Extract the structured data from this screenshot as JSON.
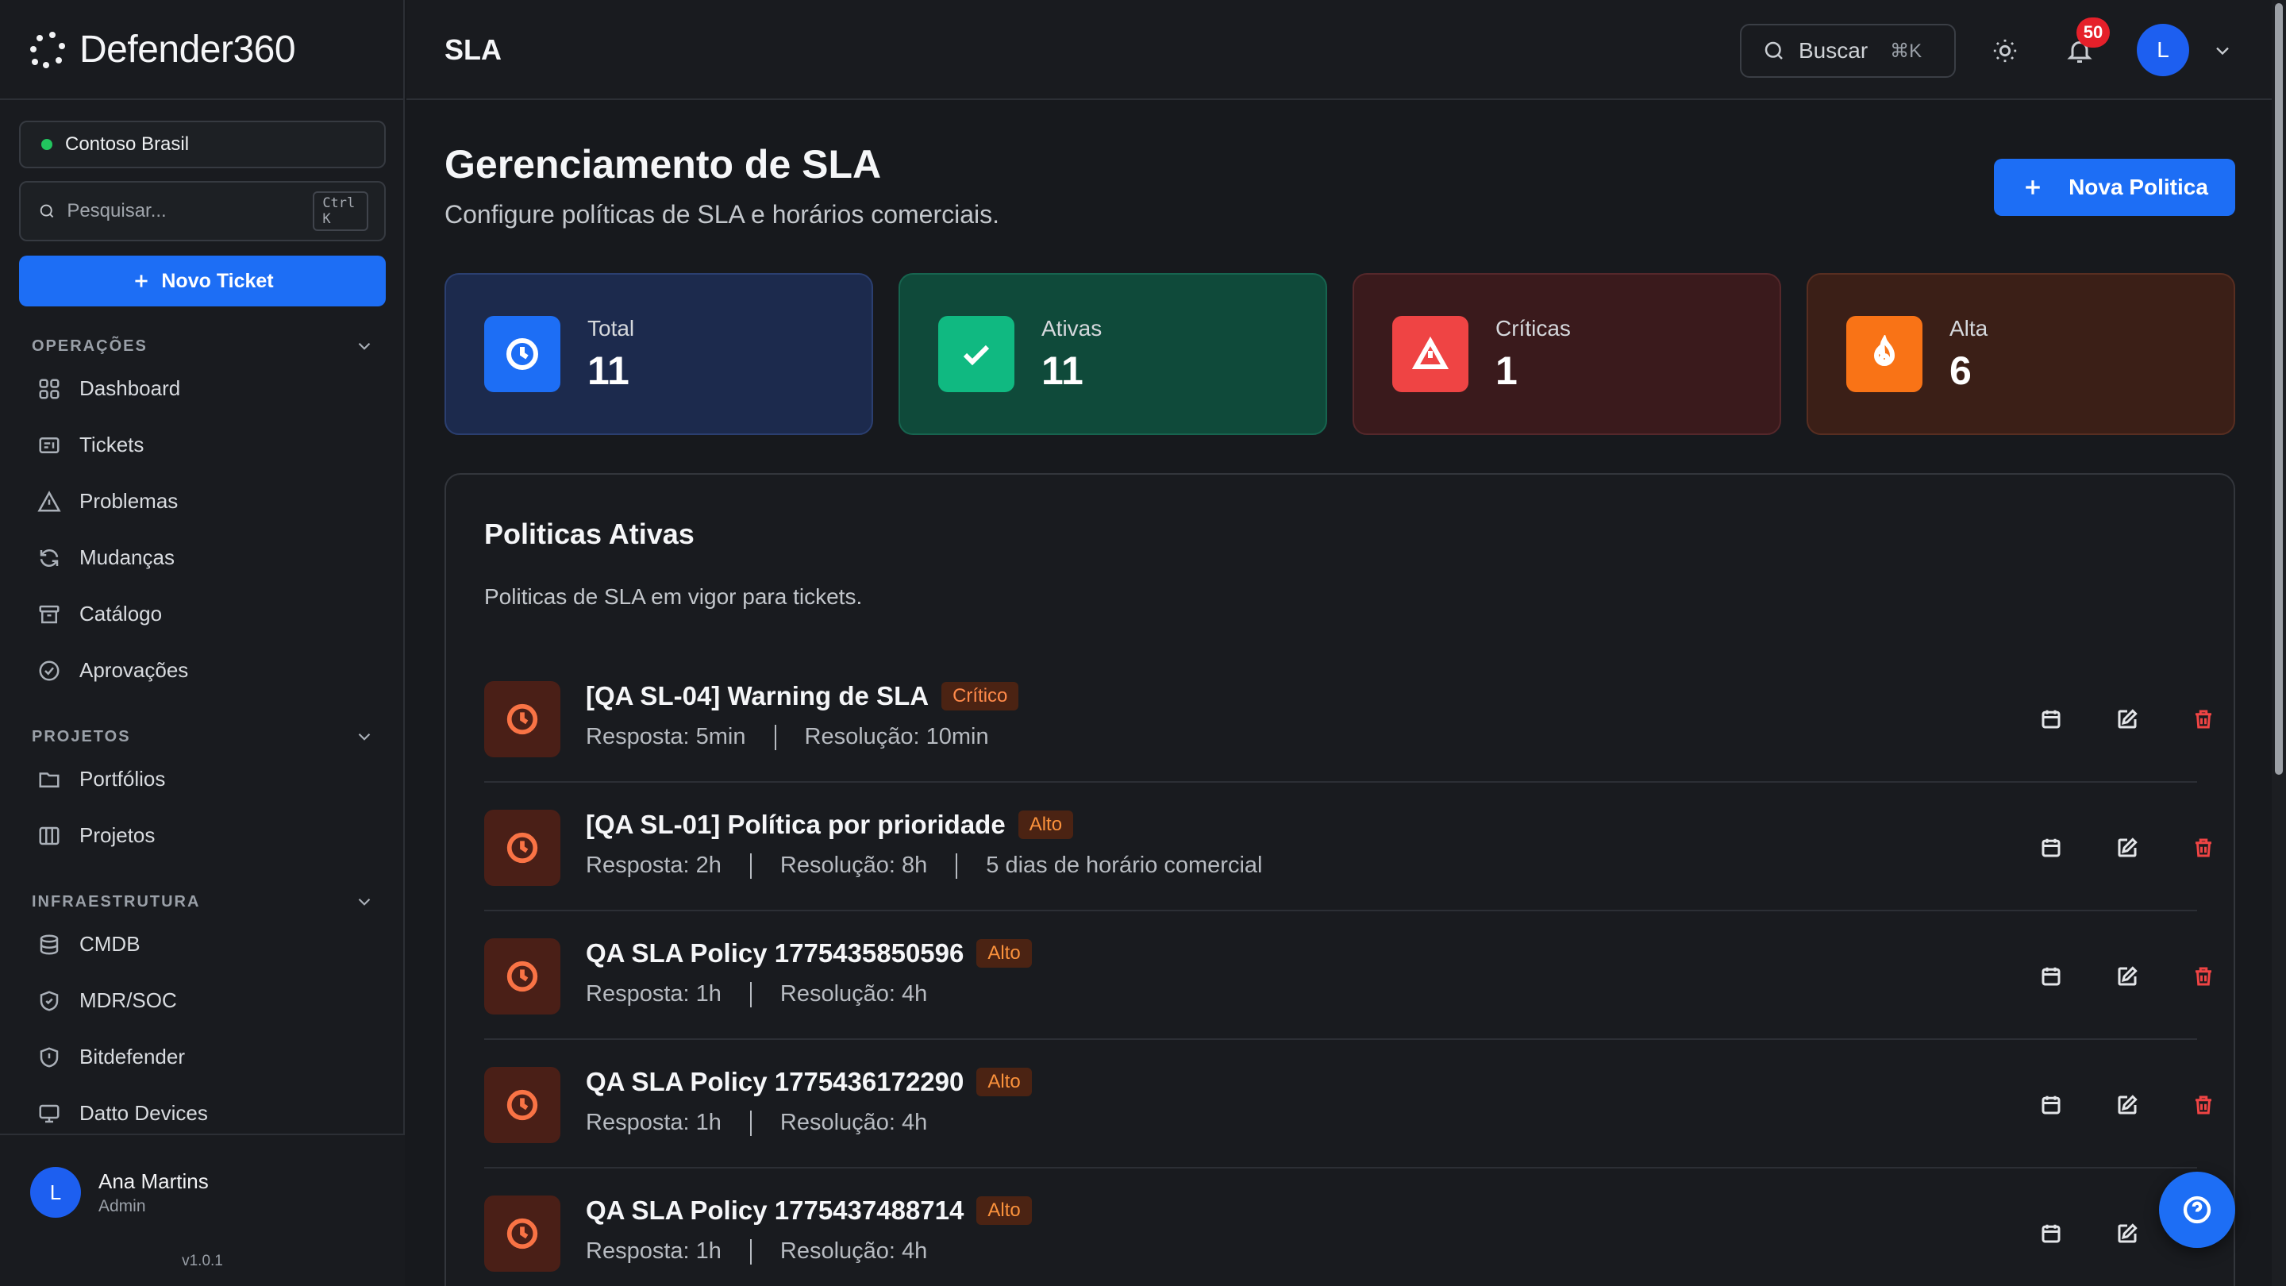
{
  "app": {
    "brand": "Defender360",
    "colors": {
      "accent": "#1d6ef5",
      "background": "#17191d",
      "surface": "#191b1f",
      "success": "#22c55e",
      "danger": "#ef4444",
      "warning": "#f97316"
    }
  },
  "sidebar": {
    "org": {
      "name": "Contoso Brasil",
      "status_color": "#22c55e"
    },
    "search": {
      "placeholder": "Pesquisar...",
      "shortcut": "Ctrl K",
      "icon": "search-icon"
    },
    "new_ticket_label": "Novo Ticket",
    "sections": [
      {
        "title": "OPERAÇÕES",
        "items": [
          {
            "label": "Dashboard",
            "icon": "grid-icon"
          },
          {
            "label": "Tickets",
            "icon": "ticket-icon"
          },
          {
            "label": "Problemas",
            "icon": "warning-icon"
          },
          {
            "label": "Mudanças",
            "icon": "refresh-icon"
          },
          {
            "label": "Catálogo",
            "icon": "archive-icon"
          },
          {
            "label": "Aprovações",
            "icon": "check-circle-icon"
          }
        ]
      },
      {
        "title": "PROJETOS",
        "items": [
          {
            "label": "Portfólios",
            "icon": "folder-icon"
          },
          {
            "label": "Projetos",
            "icon": "columns-icon"
          }
        ]
      },
      {
        "title": "INFRAESTRUTURA",
        "items": [
          {
            "label": "CMDB",
            "icon": "database-icon"
          },
          {
            "label": "MDR/SOC",
            "icon": "shield-check-icon"
          },
          {
            "label": "Bitdefender",
            "icon": "shield-icon"
          },
          {
            "label": "Datto Devices",
            "icon": "monitor-icon"
          }
        ]
      }
    ],
    "user": {
      "initial": "L",
      "name": "Ana Martins",
      "role": "Admin"
    },
    "version": "v1.0.1"
  },
  "topbar": {
    "crumb": "SLA",
    "search_label": "Buscar",
    "search_shortcut": "⌘K",
    "notifications_count": "50",
    "avatar_initial": "L"
  },
  "page": {
    "title": "Gerenciamento de SLA",
    "subtitle": "Configure políticas de SLA e horários comerciais.",
    "primary_action": "Nova Politica"
  },
  "stats": [
    {
      "label": "Total",
      "value": "11",
      "icon": "clock-icon",
      "color": "#1d6ef5"
    },
    {
      "label": "Ativas",
      "value": "11",
      "icon": "check-icon",
      "color": "#10b981"
    },
    {
      "label": "Críticas",
      "value": "1",
      "icon": "alert-triangle-icon",
      "color": "#ef4444"
    },
    {
      "label": "Alta",
      "value": "6",
      "icon": "flame-icon",
      "color": "#f97316"
    }
  ],
  "policies_panel": {
    "title": "Politicas Ativas",
    "subtitle": "Politicas de SLA em vigor para tickets.",
    "policies": [
      {
        "name": "[QA SL-04] Warning de SLA",
        "priority": "Crítico",
        "meta": [
          "Resposta: 5min",
          "Resolução: 10min"
        ]
      },
      {
        "name": "[QA SL-01] Política por prioridade",
        "priority": "Alto",
        "meta": [
          "Resposta: 2h",
          "Resolução: 8h",
          "5 dias de horário comercial"
        ]
      },
      {
        "name": "QA SLA Policy 1775435850596",
        "priority": "Alto",
        "meta": [
          "Resposta: 1h",
          "Resolução: 4h"
        ]
      },
      {
        "name": "QA SLA Policy 1775436172290",
        "priority": "Alto",
        "meta": [
          "Resposta: 1h",
          "Resolução: 4h"
        ]
      },
      {
        "name": "QA SLA Policy 1775437488714",
        "priority": "Alto",
        "meta": [
          "Resposta: 1h",
          "Resolução: 4h"
        ]
      }
    ]
  }
}
